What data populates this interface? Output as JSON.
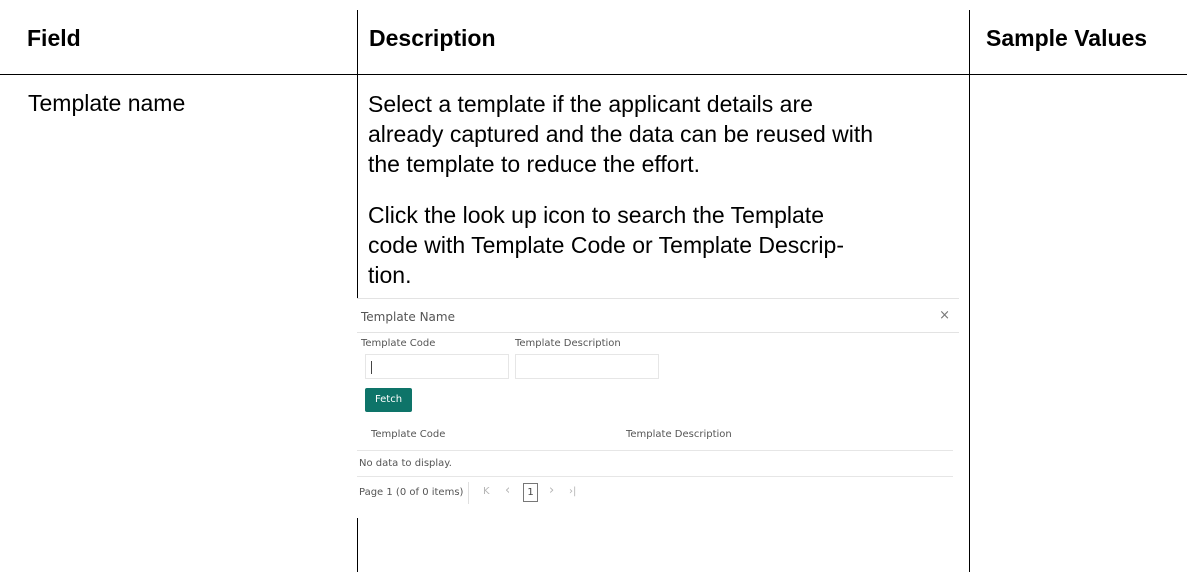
{
  "table": {
    "headers": [
      "Field",
      "Description",
      "Sample Values"
    ],
    "row": {
      "field": "Template name",
      "description_lines": [
        "Select a template if the applicant details are",
        "already captured and the data can be reused with",
        "the template to reduce the effort.",
        "Click the look up icon to search the Template",
        "code with Template Code or Template Descrip-",
        "tion."
      ]
    }
  },
  "dialog": {
    "title": "Template Name",
    "close_glyph": "×",
    "field_code_label": "Template Code",
    "field_desc_label": "Template Description",
    "fetch_label": "Fetch",
    "columns": [
      "Template Code",
      "Template Description"
    ],
    "empty_message": "No data to display.",
    "pager": {
      "summary": "Page  1  (0 of 0 items)",
      "first_glyph": "K",
      "prev_glyph": "‹",
      "current_page": "1",
      "next_glyph": "›",
      "last_glyph": "›|"
    }
  }
}
